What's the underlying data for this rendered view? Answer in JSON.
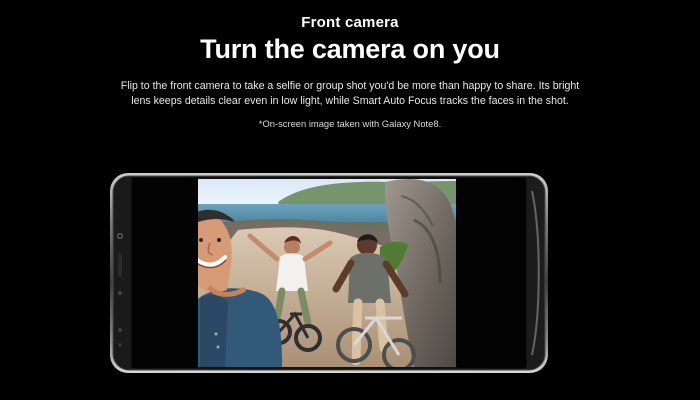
{
  "hero": {
    "eyebrow": "Front camera",
    "headline": "Turn the camera on you",
    "body_line_1": "Flip to the front camera to take a selfie or group shot you'd be more than happy to share. Its bright",
    "body_line_2": "lens keeps details clear even in low light, while Smart Auto Focus tracks the faces in the shot.",
    "footnote": "*On-screen image taken with Galaxy Note8."
  },
  "colors": {
    "background": "#000000",
    "text": "#ffffff",
    "phone_frame": "#9b9b9b",
    "screen_black": "#050505"
  },
  "icons": {
    "camera": "front-camera-icon",
    "sensor": "sensor-icon"
  }
}
